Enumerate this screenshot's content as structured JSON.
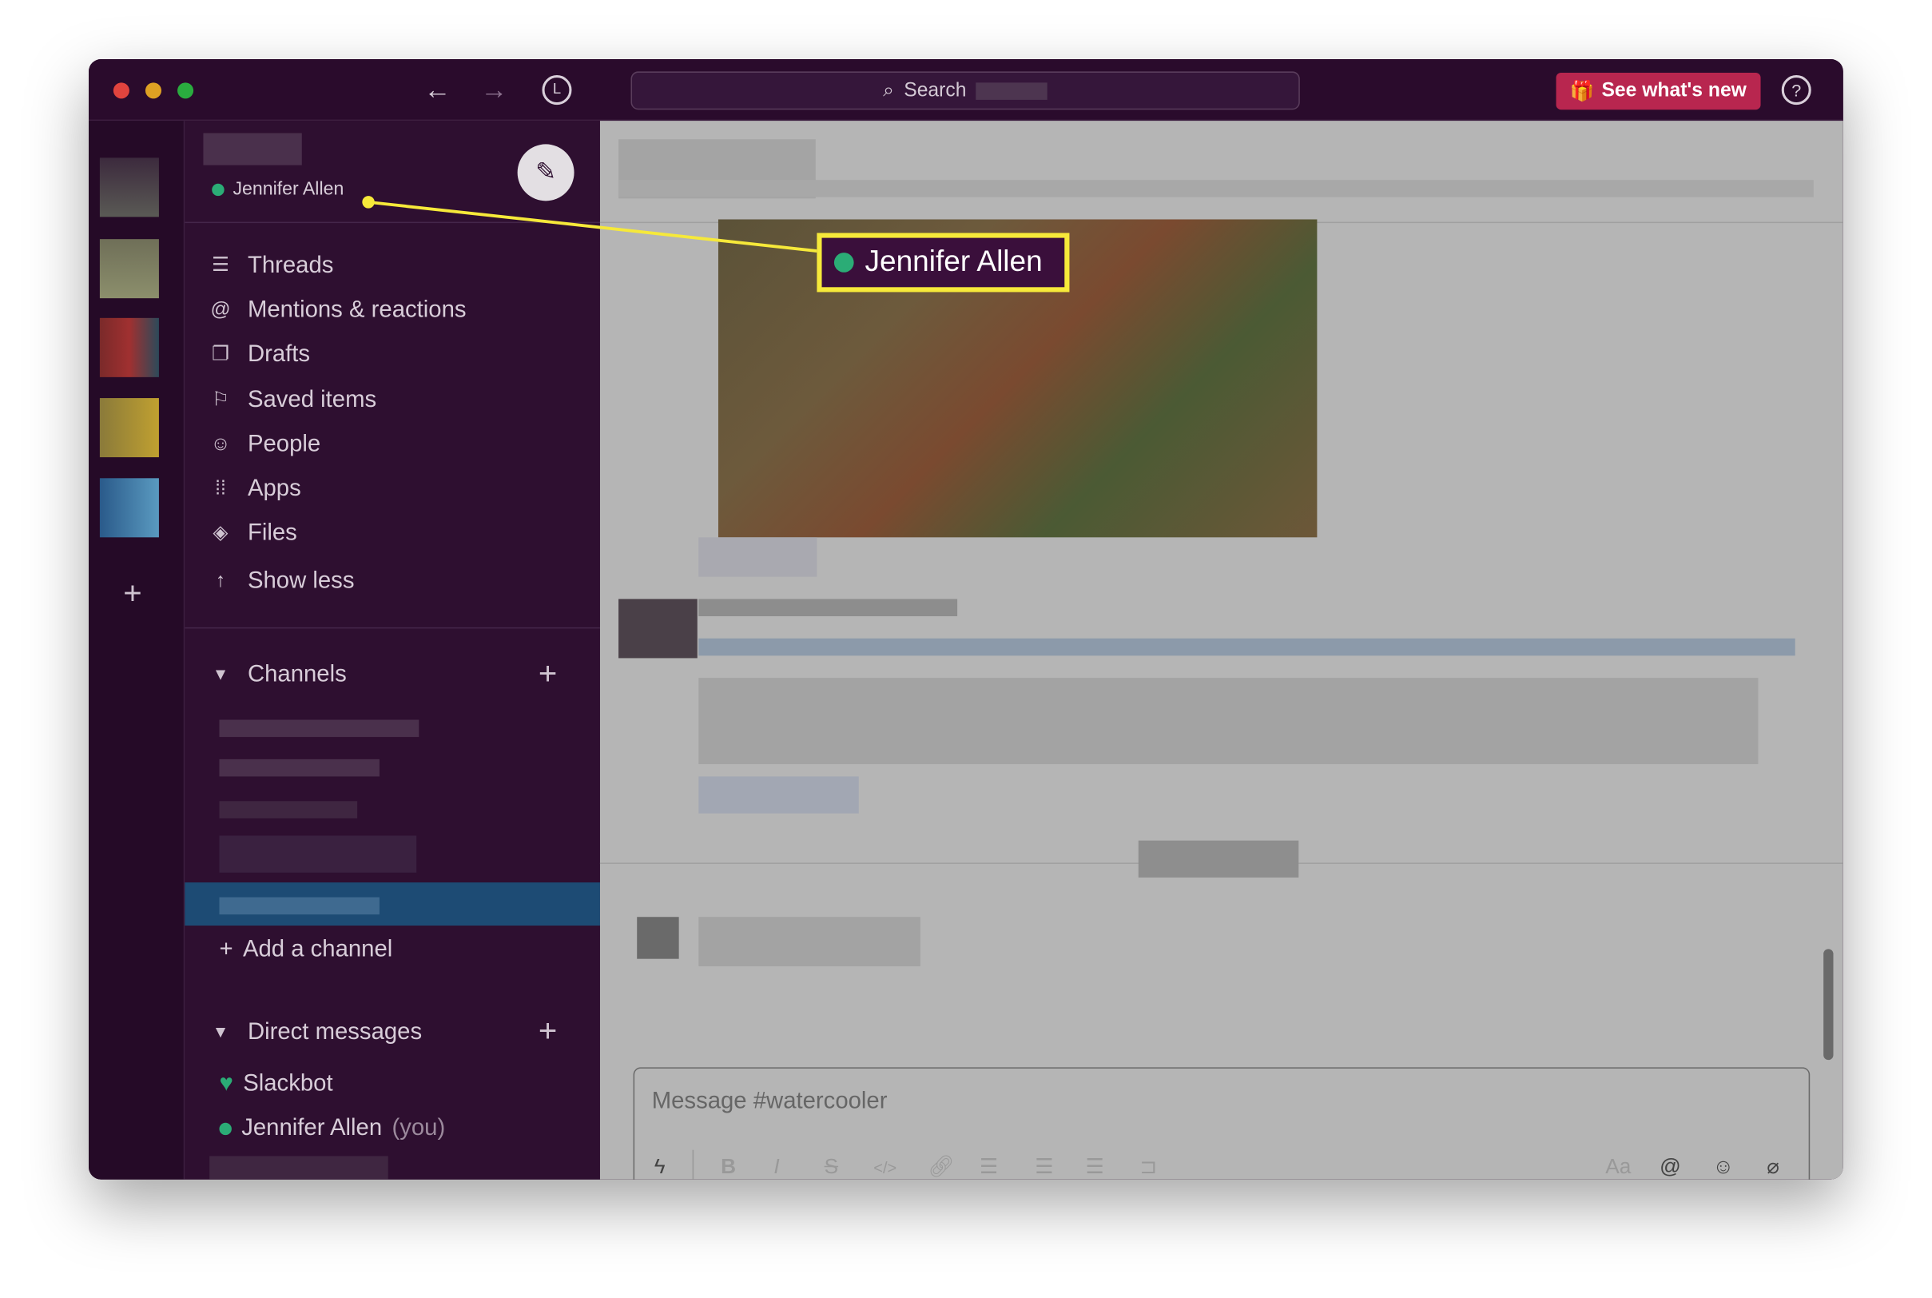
{
  "titlebar": {
    "search_label": "Search",
    "whats_new_label": "See what's new",
    "help_icon": "?"
  },
  "user": {
    "name": "Jennifer Allen",
    "status_color": "#2bac76"
  },
  "nav": [
    {
      "label": "Threads",
      "icon": "threads-icon"
    },
    {
      "label": "Mentions & reactions",
      "icon": "at-icon"
    },
    {
      "label": "Drafts",
      "icon": "drafts-icon"
    },
    {
      "label": "Saved items",
      "icon": "bookmark-icon"
    },
    {
      "label": "People",
      "icon": "people-icon"
    },
    {
      "label": "Apps",
      "icon": "apps-icon"
    },
    {
      "label": "Files",
      "icon": "files-icon"
    },
    {
      "label": "Show less",
      "icon": "arrow-up-icon"
    }
  ],
  "channels": {
    "header": "Channels",
    "add_label": "Add a channel"
  },
  "dms": {
    "header": "Direct messages",
    "items": [
      {
        "label": "Slackbot"
      },
      {
        "label": "Jennifer Allen",
        "suffix": "(you)"
      }
    ]
  },
  "composer": {
    "placeholder": "Message #watercooler",
    "format_label": "Aa"
  },
  "callout": {
    "label": "Jennifer Allen"
  },
  "colors": {
    "sidebar": "#2e0f30",
    "selected": "#1d4b74",
    "accent": "#b8264f",
    "highlight": "#f6e93a"
  }
}
